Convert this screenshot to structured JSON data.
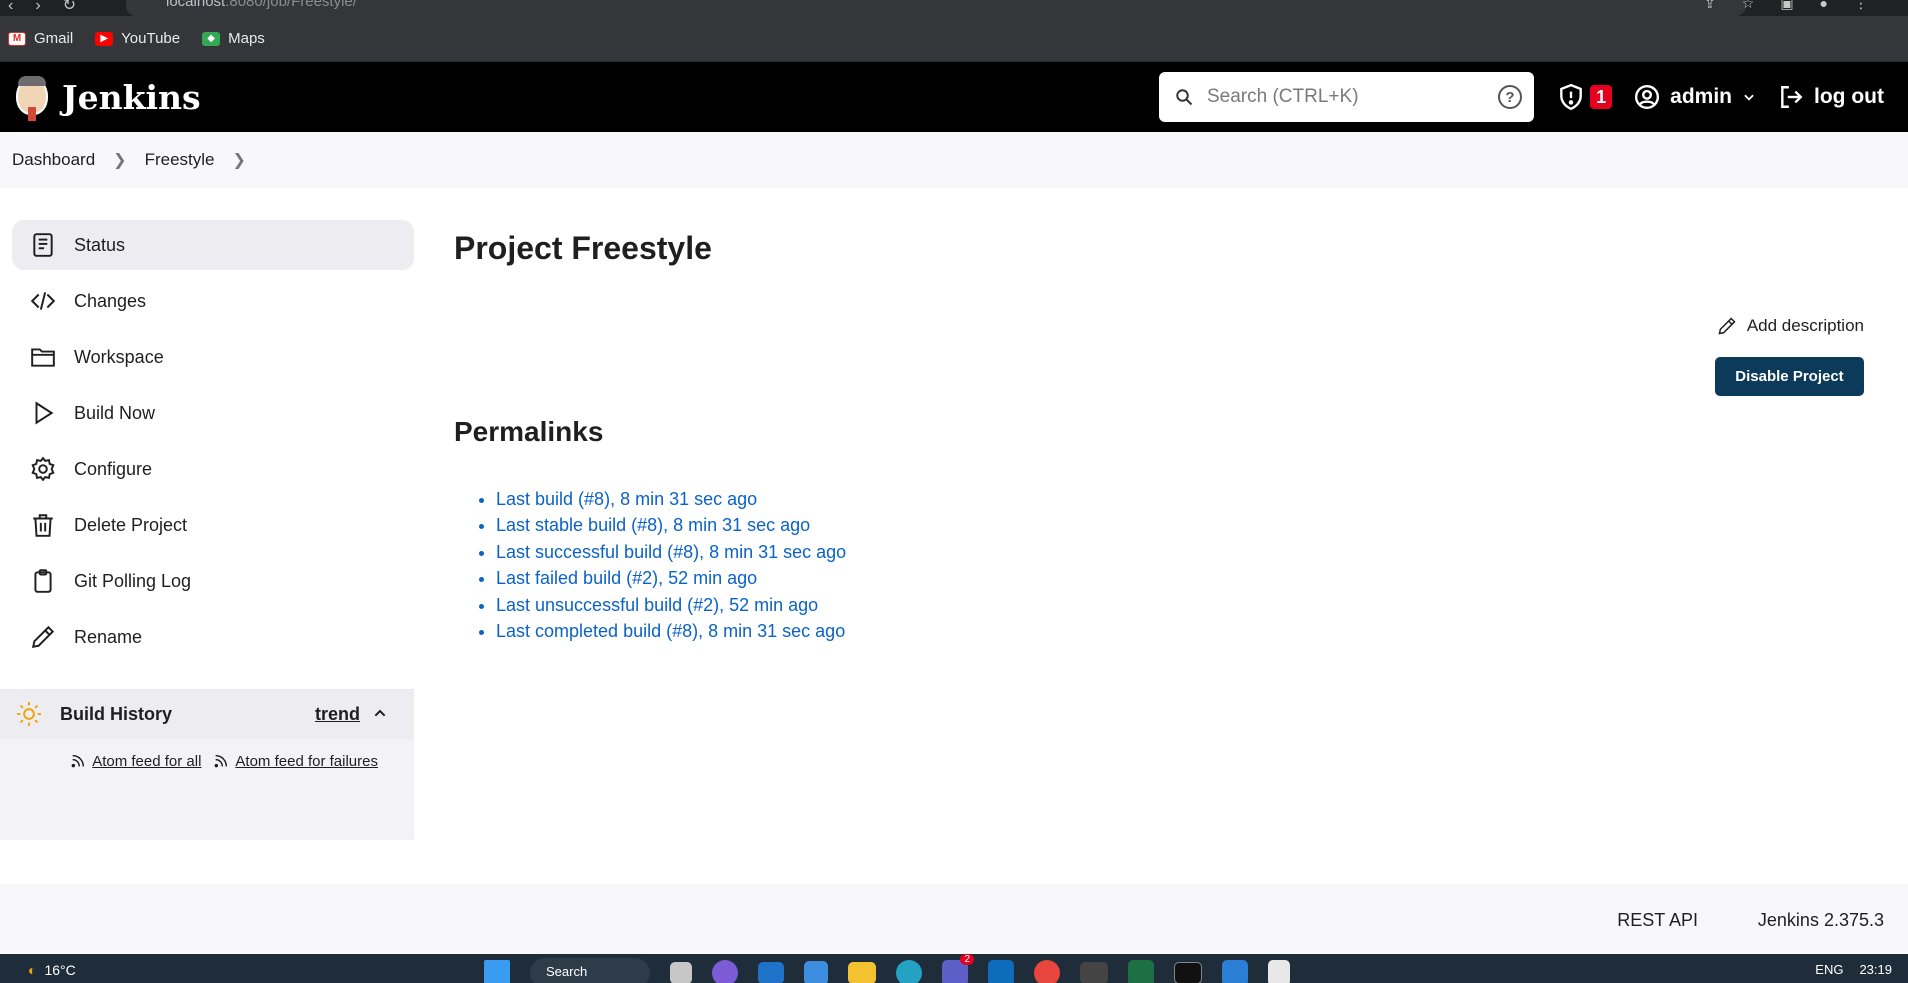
{
  "browser": {
    "url_host": "localhost",
    "url_rest": ":8080/job/Freestyle/",
    "bookmarks": [
      {
        "label": "Gmail",
        "icon": "gmail-icon"
      },
      {
        "label": "YouTube",
        "icon": "youtube-icon"
      },
      {
        "label": "Maps",
        "icon": "maps-icon"
      }
    ]
  },
  "header": {
    "brand": "Jenkins",
    "search_placeholder": "Search (CTRL+K)",
    "security_count": "1",
    "user": "admin",
    "logout": "log out"
  },
  "breadcrumb": [
    "Dashboard",
    "Freestyle"
  ],
  "sidebar": {
    "items": [
      {
        "label": "Status",
        "icon": "status-icon"
      },
      {
        "label": "Changes",
        "icon": "code-icon"
      },
      {
        "label": "Workspace",
        "icon": "folder-icon"
      },
      {
        "label": "Build Now",
        "icon": "play-icon"
      },
      {
        "label": "Configure",
        "icon": "gear-icon"
      },
      {
        "label": "Delete Project",
        "icon": "trash-icon"
      },
      {
        "label": "Git Polling Log",
        "icon": "clipboard-icon"
      },
      {
        "label": "Rename",
        "icon": "pencil-icon"
      }
    ],
    "build_history": {
      "title": "Build History",
      "trend": "trend",
      "feed_all": "Atom feed for all",
      "feed_failures": "Atom feed for failures"
    }
  },
  "main": {
    "title": "Project Freestyle",
    "add_description": "Add description",
    "disable_button": "Disable Project",
    "permalinks_title": "Permalinks",
    "permalinks": [
      "Last build (#8), 8 min 31 sec ago",
      "Last stable build (#8), 8 min 31 sec ago",
      "Last successful build (#8), 8 min 31 sec ago",
      "Last failed build (#2), 52 min ago",
      "Last unsuccessful build (#2), 52 min ago",
      "Last completed build (#8), 8 min 31 sec ago"
    ]
  },
  "footer": {
    "rest_api": "REST API",
    "version": "Jenkins 2.375.3"
  },
  "taskbar": {
    "temperature": "16°C",
    "search": "Search",
    "language": "ENG",
    "time": "23:19",
    "teams_badge": "2"
  }
}
